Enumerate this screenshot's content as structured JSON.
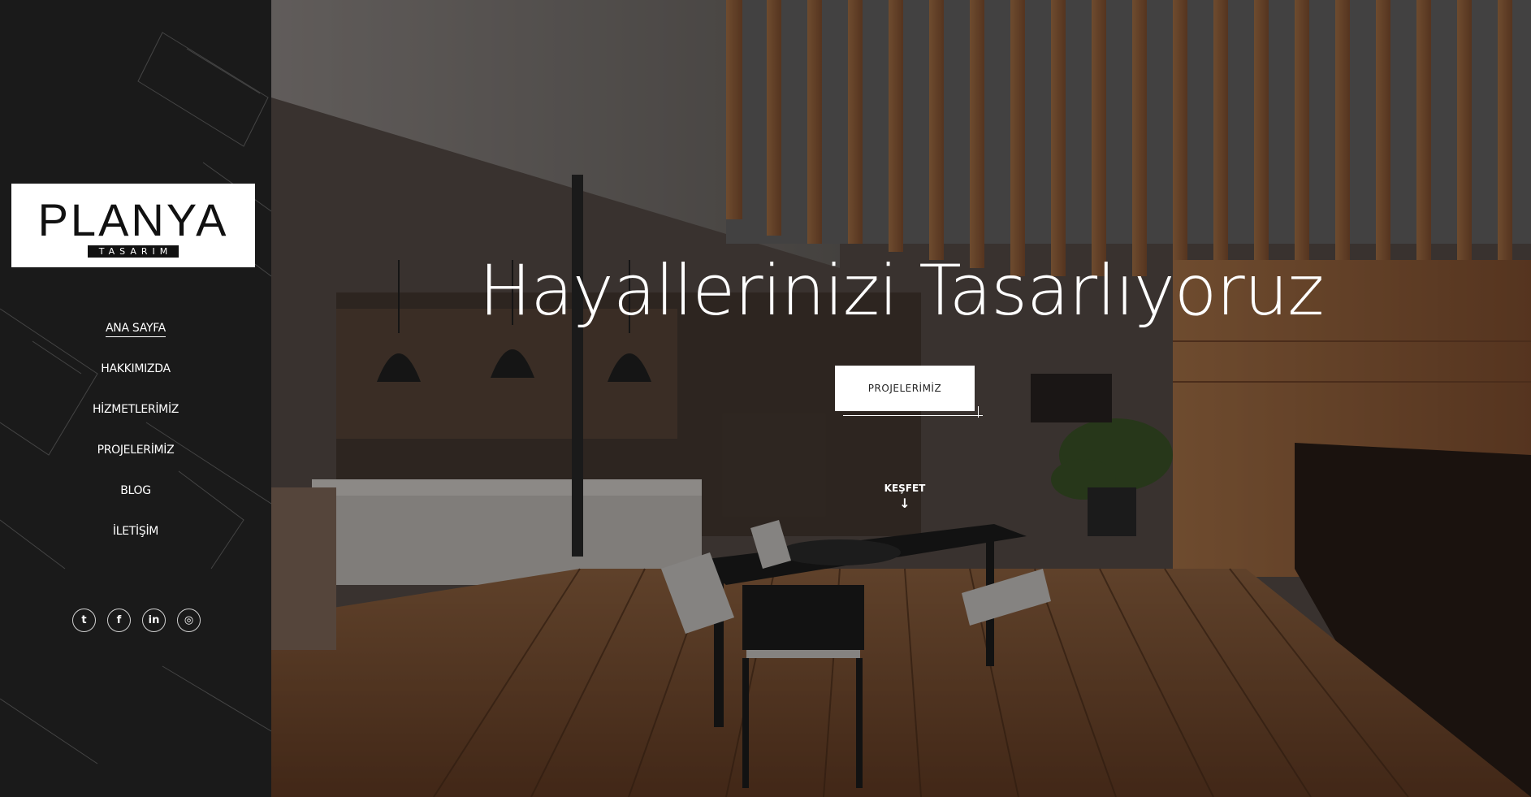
{
  "brand": {
    "name": "PLANYA",
    "sub": "TASARIM"
  },
  "nav": [
    {
      "label": "ANA SAYFA",
      "active": true
    },
    {
      "label": "HAKKIMIZDA",
      "active": false
    },
    {
      "label": "HİZMETLERİMİZ",
      "active": false
    },
    {
      "label": "PROJELERİMİZ",
      "active": false
    },
    {
      "label": "BLOG",
      "active": false
    },
    {
      "label": "İLETİŞİM",
      "active": false
    }
  ],
  "social": [
    {
      "icon": "twitter-icon",
      "glyph": "t"
    },
    {
      "icon": "facebook-icon",
      "glyph": "f"
    },
    {
      "icon": "linkedin-icon",
      "glyph": "in"
    },
    {
      "icon": "instagram-icon",
      "glyph": "◎"
    }
  ],
  "hero": {
    "title": "Hayallerinizi Tasarlıyoruz",
    "button": "PROJELERİMİZ",
    "explore": "KEŞFET",
    "explore_arrow": "↓"
  },
  "colors": {
    "sidebar": "#1a1a1a",
    "wood": "#8a5a36",
    "accent": "#ffffff"
  }
}
